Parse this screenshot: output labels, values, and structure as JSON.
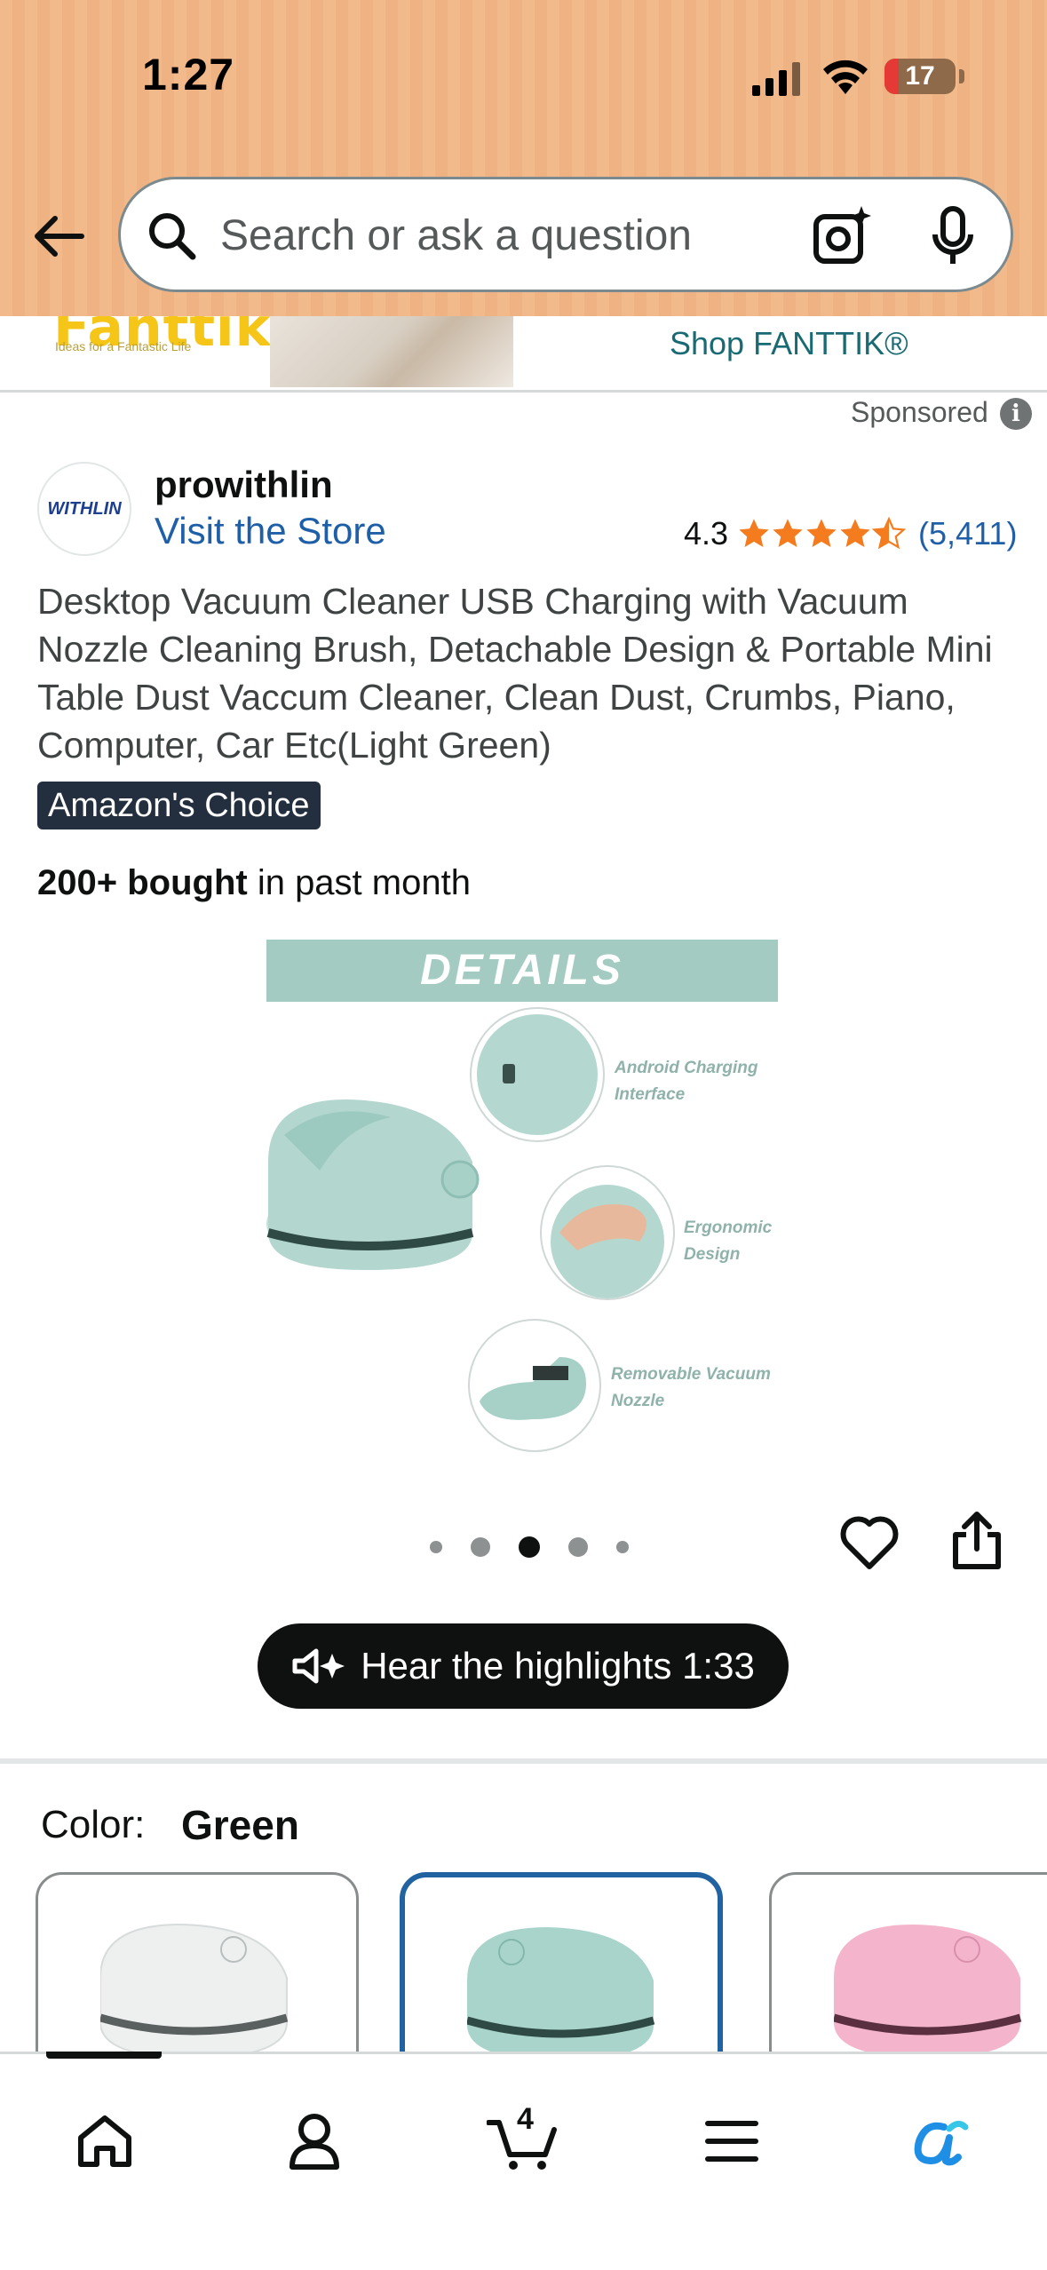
{
  "status_bar": {
    "time": "1:27",
    "battery": "17"
  },
  "search": {
    "placeholder": "Search or ask a question"
  },
  "banner": {
    "logo": "Fanttik",
    "tagline": "Ideas for a Fantastic Life",
    "shop_label": "Shop FANTTIK®"
  },
  "sponsored": {
    "label": "Sponsored",
    "info_icon": "i"
  },
  "seller": {
    "logo_text": "WITHLIN",
    "name": "prowithlin",
    "visit_store": "Visit the Store"
  },
  "rating": {
    "value": "4.3",
    "stars": 4.5,
    "count": "(5,411)",
    "star_color": "#f47c1f"
  },
  "product": {
    "title": "Desktop Vacuum Cleaner USB Charging with Vacuum Nozzle Cleaning Brush, Detachable Design & Portable Mini Table Dust Vaccum Cleaner, Clean Dust, Crumbs, Piano, Computer, Car Etc(Light Green)",
    "badge": "Amazon's Choice",
    "bought_bold": "200+ bought",
    "bought_rest": " in past month"
  },
  "image": {
    "header": "DETAILS",
    "callouts": [
      "Android Charging Interface",
      "Ergonomic Design",
      "Removable Vacuum Nozzle"
    ],
    "carousel": {
      "count": 5,
      "active": 3
    }
  },
  "audio": {
    "label": "Hear the highlights 1:33"
  },
  "color": {
    "label": "Color:",
    "value": "Green",
    "swatches": [
      "#f2f3f3",
      "#a8d4cb",
      "#f4b4cc"
    ],
    "selected": 1
  },
  "nav": {
    "cart_count": "4",
    "items": [
      "home-icon",
      "account-icon",
      "cart-icon",
      "menu-icon",
      "rufus-icon"
    ]
  },
  "colors": {
    "header": "#f2b98a",
    "link": "#1f5fa8",
    "accent_blue": "#2162a1",
    "teal_image": "#a3cbc1"
  }
}
